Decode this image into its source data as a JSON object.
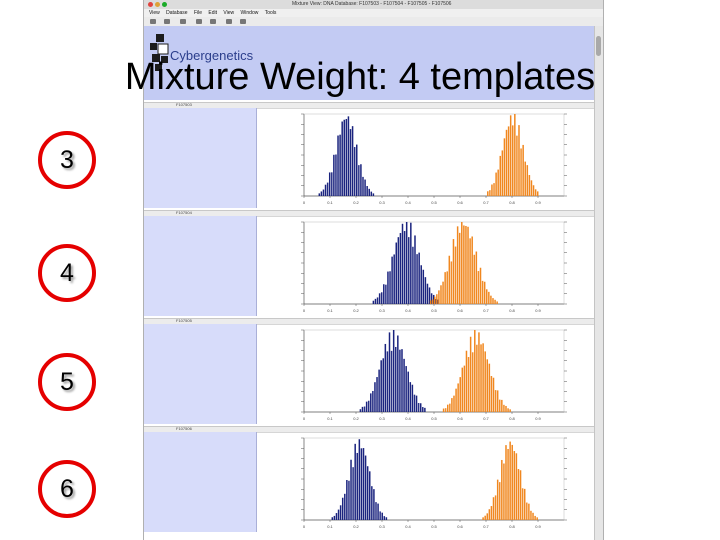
{
  "slide": {
    "title": "Mixture Weight: 4 templates",
    "numbers": [
      "3",
      "4",
      "5",
      "6"
    ]
  },
  "app": {
    "window_title": "Mixture View: DNA Database: F107503 - F107504 - F107505 - F107506",
    "menu": [
      "View",
      "Database",
      "File",
      "Edit",
      "View",
      "Window",
      "Tools"
    ],
    "logo_text": "Cybergenetics"
  },
  "panels": [
    {
      "id": "F107503"
    },
    {
      "id": "F107504"
    },
    {
      "id": "F107505"
    },
    {
      "id": "F107506"
    }
  ],
  "colors": {
    "blue": "#1a237e",
    "orange": "#f0871f",
    "circle_border": "#e50000",
    "banner": "#c3cbf3",
    "side_panel": "#d7dcfa"
  },
  "chart_data": [
    {
      "type": "bar",
      "xlim": [
        0,
        1
      ],
      "x_ticks": [
        "0",
        "0.1",
        "0.2",
        "0.3",
        "0.4",
        "0.5",
        "0.6",
        "0.7",
        "0.8",
        "0.9"
      ],
      "series": [
        {
          "color": "#1a237e",
          "center": 0.16,
          "spread": 0.04,
          "peak": 0.9
        },
        {
          "color": "#f0871f",
          "center": 0.8,
          "spread": 0.04,
          "peak": 0.9
        }
      ]
    },
    {
      "type": "bar",
      "xlim": [
        0,
        1
      ],
      "x_ticks": [
        "0",
        "0.1",
        "0.2",
        "0.3",
        "0.4",
        "0.5",
        "0.6",
        "0.7",
        "0.8",
        "0.9"
      ],
      "series": [
        {
          "color": "#1a237e",
          "center": 0.39,
          "spread": 0.05,
          "peak": 0.92
        },
        {
          "color": "#f0871f",
          "center": 0.61,
          "spread": 0.05,
          "peak": 0.92
        }
      ]
    },
    {
      "type": "bar",
      "xlim": [
        0,
        1
      ],
      "x_ticks": [
        "0",
        "0.1",
        "0.2",
        "0.3",
        "0.4",
        "0.5",
        "0.6",
        "0.7",
        "0.8",
        "0.9"
      ],
      "series": [
        {
          "color": "#1a237e",
          "center": 0.34,
          "spread": 0.05,
          "peak": 0.88
        },
        {
          "color": "#f0871f",
          "center": 0.66,
          "spread": 0.05,
          "peak": 0.88
        }
      ]
    },
    {
      "type": "bar",
      "xlim": [
        0,
        1
      ],
      "x_ticks": [
        "0",
        "0.1",
        "0.2",
        "0.3",
        "0.4",
        "0.5",
        "0.6",
        "0.7",
        "0.8",
        "0.9"
      ],
      "series": [
        {
          "color": "#1a237e",
          "center": 0.21,
          "spread": 0.04,
          "peak": 0.88
        },
        {
          "color": "#f0871f",
          "center": 0.79,
          "spread": 0.04,
          "peak": 0.88
        }
      ]
    }
  ]
}
